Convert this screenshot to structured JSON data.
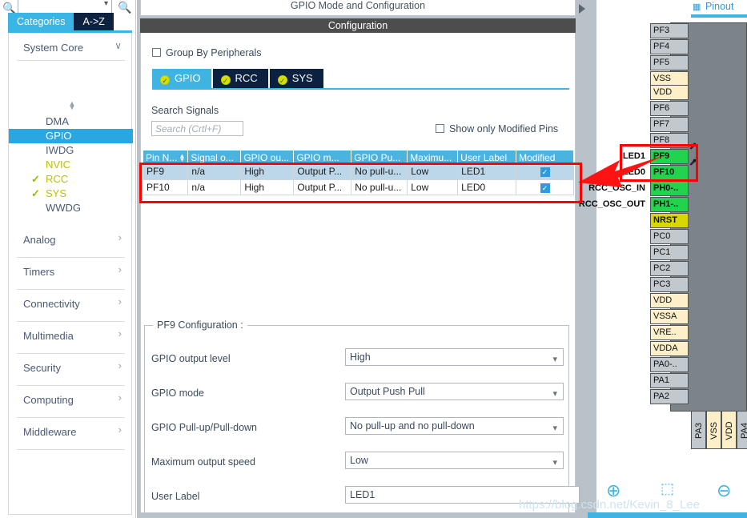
{
  "sidebar": {
    "search": {
      "placeholder": "",
      "value": "",
      "icon": "search-icon"
    },
    "tabs": [
      {
        "label": "Categories",
        "active": true
      },
      {
        "label": "A->Z",
        "active": false
      }
    ],
    "group": {
      "label": "System Core",
      "chevron": "∨"
    },
    "core_items": [
      {
        "label": "DMA",
        "state": "normal"
      },
      {
        "label": "GPIO",
        "state": "selected"
      },
      {
        "label": "IWDG",
        "state": "normal"
      },
      {
        "label": "NVIC",
        "state": "configured"
      },
      {
        "label": "RCC",
        "state": "ok"
      },
      {
        "label": "SYS",
        "state": "ok"
      },
      {
        "label": "WWDG",
        "state": "normal"
      }
    ],
    "categories": [
      {
        "label": "Analog",
        "chevron": "›"
      },
      {
        "label": "Timers",
        "chevron": "›"
      },
      {
        "label": "Connectivity",
        "chevron": "›"
      },
      {
        "label": "Multimedia",
        "chevron": "›"
      },
      {
        "label": "Security",
        "chevron": "›"
      },
      {
        "label": "Computing",
        "chevron": "›"
      },
      {
        "label": "Middleware",
        "chevron": "›"
      }
    ]
  },
  "center": {
    "mode_title": "GPIO Mode and Configuration",
    "configuration_bar": "Configuration",
    "group_by_peripherals": {
      "label": "Group By Peripherals",
      "checked": false
    },
    "peripheral_tabs": [
      {
        "label": "GPIO",
        "active": true,
        "status": "ok"
      },
      {
        "label": "RCC",
        "active": false,
        "status": "ok"
      },
      {
        "label": "SYS",
        "active": false,
        "status": "ok"
      }
    ],
    "search_signals_label": "Search Signals",
    "search_signals_placeholder": "Search (Crtl+F)",
    "search_signals_value": "",
    "show_only_modified": {
      "label": "Show only Modified Pins",
      "checked": false
    },
    "table": {
      "headers": [
        "Pin N...",
        "Signal o...",
        "GPIO ou...",
        "GPIO m...",
        "GPIO Pu...",
        "Maximu...",
        "User Label",
        "Modified"
      ],
      "sorted_column": 0,
      "rows": [
        {
          "pin_name": "PF9",
          "signal": "n/a",
          "gpio_output": "High",
          "gpio_mode": "Output P...",
          "gpio_pull": "No pull-u...",
          "maximum_speed": "Low",
          "user_label": "LED1",
          "modified": true,
          "selected": true
        },
        {
          "pin_name": "PF10",
          "signal": "n/a",
          "gpio_output": "High",
          "gpio_mode": "Output P...",
          "gpio_pull": "No pull-u...",
          "maximum_speed": "Low",
          "user_label": "LED0",
          "modified": true,
          "selected": false
        }
      ]
    },
    "pin_config": {
      "legend": "PF9 Configuration :",
      "fields": [
        {
          "label": "GPIO output level",
          "value": "High",
          "type": "select"
        },
        {
          "label": "GPIO mode",
          "value": "Output Push Pull",
          "type": "select"
        },
        {
          "label": "GPIO Pull-up/Pull-down",
          "value": "No pull-up and no pull-down",
          "type": "select"
        },
        {
          "label": "Maximum output speed",
          "value": "Low",
          "type": "select"
        },
        {
          "label": "User Label",
          "value": "LED1",
          "type": "text"
        }
      ]
    }
  },
  "right": {
    "pinout_tab": {
      "label": "Pinout",
      "icon": "chip-icon"
    },
    "left_pins": [
      {
        "name": "PF3",
        "color": "gray",
        "label": ""
      },
      {
        "name": "PF4",
        "color": "gray",
        "label": ""
      },
      {
        "name": "PF5",
        "color": "gray",
        "label": ""
      },
      {
        "name": "VSS",
        "color": "cream",
        "label": ""
      },
      {
        "name": "VDD",
        "color": "cream",
        "label": ""
      },
      {
        "name": "PF6",
        "color": "gray",
        "label": ""
      },
      {
        "name": "PF7",
        "color": "gray",
        "label": ""
      },
      {
        "name": "PF8",
        "color": "gray",
        "label": ""
      },
      {
        "name": "PF9",
        "color": "green",
        "label": "LED1"
      },
      {
        "name": "PF10",
        "color": "green",
        "label": "LED0"
      },
      {
        "name": "PH0-..",
        "color": "green",
        "label": "RCC_OSC_IN"
      },
      {
        "name": "PH1-..",
        "color": "green",
        "label": "RCC_OSC_OUT"
      },
      {
        "name": "NRST",
        "color": "yellow",
        "label": ""
      },
      {
        "name": "PC0",
        "color": "gray",
        "label": ""
      },
      {
        "name": "PC1",
        "color": "gray",
        "label": ""
      },
      {
        "name": "PC2",
        "color": "gray",
        "label": ""
      },
      {
        "name": "PC3",
        "color": "gray",
        "label": ""
      },
      {
        "name": "VDD",
        "color": "cream",
        "label": ""
      },
      {
        "name": "VSSA",
        "color": "cream",
        "label": ""
      },
      {
        "name": "VRE..",
        "color": "cream",
        "label": ""
      },
      {
        "name": "VDDA",
        "color": "cream",
        "label": ""
      },
      {
        "name": "PA0-..",
        "color": "gray",
        "label": ""
      },
      {
        "name": "PA1",
        "color": "gray",
        "label": ""
      },
      {
        "name": "PA2",
        "color": "gray",
        "label": ""
      }
    ],
    "bottom_pins": [
      {
        "name": "PA3",
        "color": "gray"
      },
      {
        "name": "VSS",
        "color": "cream"
      },
      {
        "name": "VDD",
        "color": "cream"
      },
      {
        "name": "PA4",
        "color": "gray"
      }
    ],
    "zoom_controls": [
      {
        "name": "zoom-in",
        "glyph": "⊕"
      },
      {
        "name": "zoom-fit",
        "glyph": "⬚"
      },
      {
        "name": "zoom-out",
        "glyph": "⊖"
      }
    ]
  },
  "watermark": "https://blog.csdn.net/Kevin_8_Lee",
  "colors": {
    "accent": "#3fb4e3",
    "tab_dark": "#0c2140",
    "selection": "#2aa6e0",
    "header_bar": "#4d4d4d",
    "table_header": "#4bb3e0",
    "row_selected": "#bcd6ea",
    "pin_green": "#22d44c",
    "pin_cream": "#fdf0c8",
    "pin_gray": "#c2c9ce",
    "pin_yellow": "#d8d800",
    "annotation_red": "#ff0000"
  }
}
